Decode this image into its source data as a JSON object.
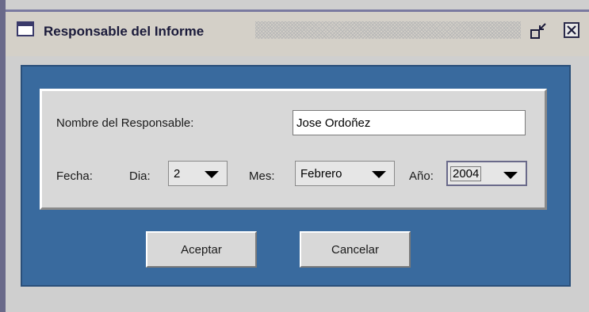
{
  "window": {
    "title": "Responsable del Informe",
    "icon": "window-icon",
    "controls": [
      "minimize-icon",
      "close-icon"
    ]
  },
  "form": {
    "responsable_label": "Nombre del Responsable:",
    "responsable_value": "Jose Ordoñez",
    "fecha_label": "Fecha:",
    "dia_label": "Dia:",
    "dia_value": "2",
    "mes_label": "Mes:",
    "mes_value": "Febrero",
    "anio_label": "Año:",
    "anio_value": "2004"
  },
  "buttons": {
    "accept_label": "Aceptar",
    "cancel_label": "Cancelar"
  },
  "colors": {
    "content_background": "#396a9e",
    "panel_background": "#d8d8d8",
    "titlebar": "#d4d0c8"
  }
}
